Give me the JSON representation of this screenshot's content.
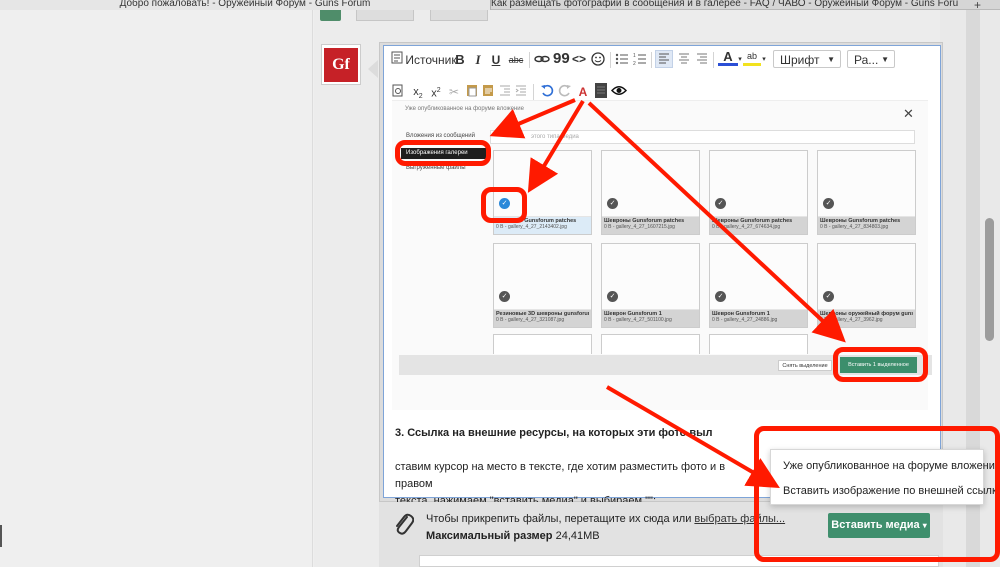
{
  "browser": {
    "tabs": [
      {
        "label": "Добро пожаловать! - Оружейный Форум - Guns Forum"
      },
      {
        "label": "Как размещать фотографии в сообщения и в галерее - FAQ / ЧАВО - Оружейный Форум - Guns Forum"
      }
    ],
    "new_tab_icon": "plus-icon"
  },
  "avatar": {
    "text": "Gf"
  },
  "toolbar": {
    "source_label": "Источник",
    "font_label": "Шрифт",
    "size_label": "Ра...",
    "row1_icons": [
      "source-icon",
      "bold-icon",
      "italic-icon",
      "underline-icon",
      "strike-icon",
      "link-icon",
      "quote-icon",
      "code-icon",
      "emoji-icon",
      "bullet-list-icon",
      "numbered-list-icon",
      "align-left-icon",
      "align-center-icon",
      "align-right-icon",
      "text-color-icon",
      "highlight-icon"
    ],
    "row2_icons": [
      "preview-doc-icon",
      "subscript-icon",
      "superscript-icon",
      "cut-icon",
      "paste-icon",
      "paste-text-icon",
      "indent-icon",
      "outdent-icon",
      "undo-icon",
      "redo-icon",
      "remove-format-icon",
      "spoiler-icon",
      "eye-icon"
    ]
  },
  "screenshot": {
    "heading": "Уже опубликованное на форуме вложение",
    "search_placeholder": "этого типа медиа",
    "sidebar": [
      "Вложения из сообщений",
      "Изображения галереи",
      "Выгруженные файлы"
    ],
    "cards": [
      {
        "title": "Шевроны Gunsforum patches",
        "sub": "0 B - gallery_4_27_2143402.jpg",
        "selected": true
      },
      {
        "title": "Шевроны Gunsforum patches",
        "sub": "0 B - gallery_4_27_1607215.jpg",
        "selected": false
      },
      {
        "title": "Шевроны Gunsforum patches",
        "sub": "0 B - gallery_4_27_674634.jpg",
        "selected": false
      },
      {
        "title": "Шевроны Gunsforum patches",
        "sub": "0 B - gallery_4_27_834803.jpg",
        "selected": false
      },
      {
        "title": "Резиновые 3D шевроны gunsforum",
        "sub": "0 B - gallery_4_27_321087.jpg",
        "selected": false
      },
      {
        "title": "Шеврон Gunsforum 1",
        "sub": "0 B - gallery_4_27_501100.jpg",
        "selected": false
      },
      {
        "title": "Шеврон Gunsforum 1",
        "sub": "0 B - gallery_4_27_24886.jpg",
        "selected": false
      },
      {
        "title": "Шевроны оружейный форум guns forum",
        "sub": "0 B - gallery_4_27_3962.jpg",
        "selected": false
      }
    ],
    "unselect_label": "Снять выделение",
    "insert_label": "Вставить 1 выделенное"
  },
  "post": {
    "heading": "3. Ссылка на внешние ресурсы, на которых эти фото выл",
    "body_line1": "ставим курсор на место в тексте, где хотим разместить фото и в правом",
    "body_line2": "текста, нажимаем \"вставить медиа\" и выбираем \"\":"
  },
  "attachments": {
    "drop_text": "Чтобы прикрепить файлы, перетащите их сюда или ",
    "choose_link": "выбрать файлы...",
    "max_size_label": "Максимальный размер",
    "max_size_value": "24,41MB"
  },
  "insert_media": {
    "button_label": "Вставить медиа",
    "menu": [
      "Уже опубликованное на форуме вложение",
      "Вставить изображение по внешней ссылке"
    ]
  },
  "annotation_color": "#ff1a00"
}
